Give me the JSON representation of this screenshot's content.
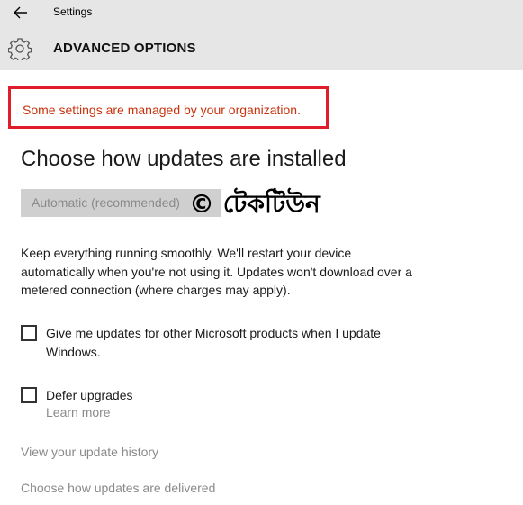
{
  "window": {
    "title": "Settings"
  },
  "page": {
    "title": "ADVANCED OPTIONS"
  },
  "notice": {
    "text": "Some settings are managed by your organization."
  },
  "updates": {
    "heading": "Choose how updates are installed",
    "dropdown_value": "Automatic (recommended)",
    "description": "Keep everything running smoothly. We'll restart your device automatically when you're not using it. Updates won't download over a metered connection (where charges may apply)."
  },
  "watermark": {
    "text": "© টেকটিউন"
  },
  "options": {
    "microsoft_products": {
      "label": "Give me updates for other Microsoft products when I update Windows.",
      "checked": false
    },
    "defer_upgrades": {
      "label": "Defer upgrades",
      "checked": false,
      "learn_more": "Learn more"
    }
  },
  "links": {
    "history": "View your update history",
    "delivery": "Choose how updates are delivered"
  },
  "icons": {
    "back": "back-arrow-icon",
    "gear": "gear-icon"
  },
  "colors": {
    "header_bg": "#e6e6e6",
    "notice_text": "#c8320c",
    "highlight_border": "#e01e2b",
    "disabled_text": "#8a8a8a"
  }
}
